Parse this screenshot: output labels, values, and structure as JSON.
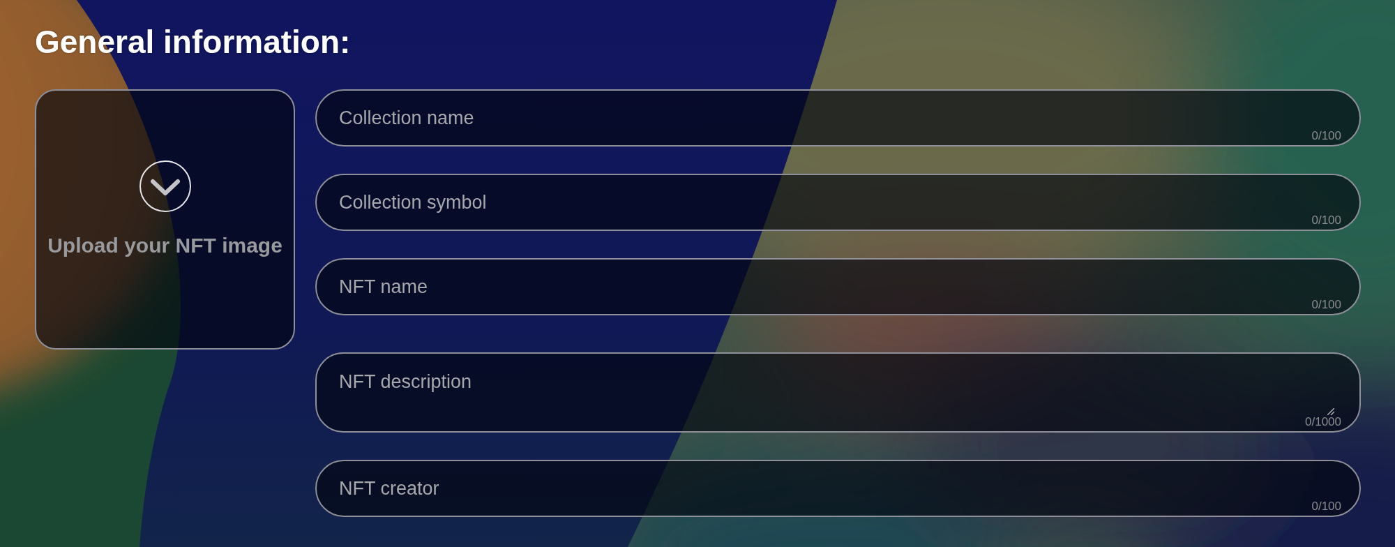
{
  "heading": "General information:",
  "upload": {
    "label": "Upload your NFT image"
  },
  "fields": [
    {
      "kind": "single",
      "placeholder": "Collection name",
      "counter": "0/100"
    },
    {
      "kind": "single",
      "placeholder": "Collection symbol",
      "counter": "0/100"
    },
    {
      "kind": "single",
      "placeholder": "NFT name",
      "counter": "0/100"
    },
    {
      "kind": "multiline",
      "placeholder": "NFT description",
      "counter": "0/1000"
    },
    {
      "kind": "single",
      "placeholder": "NFT creator",
      "counter": "0/100"
    }
  ]
}
